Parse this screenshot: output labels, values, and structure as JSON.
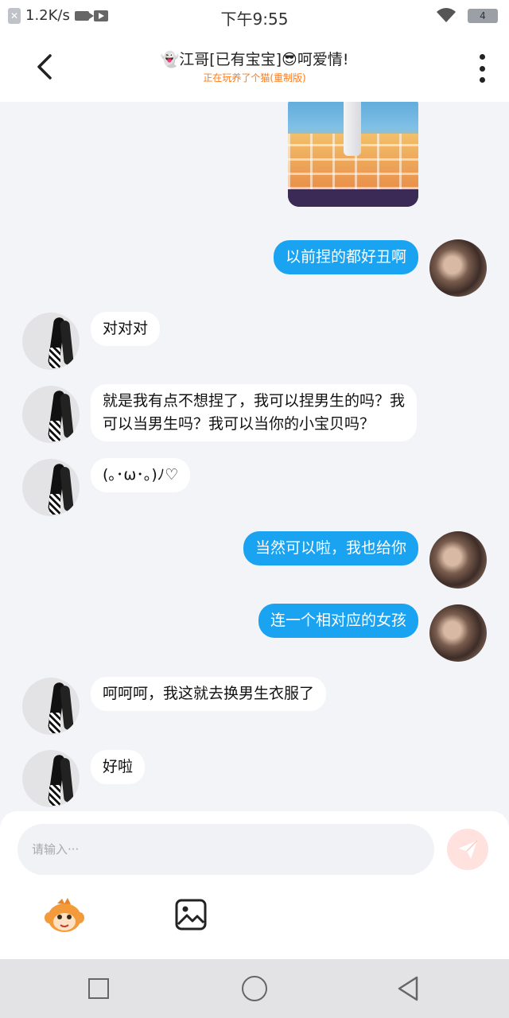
{
  "status_bar": {
    "net_speed": "1.2K/s",
    "time": "下午9:55",
    "battery": "4"
  },
  "header": {
    "title": "👻江哥[已有宝宝]😎呵爱情!",
    "subtitle": "正在玩养了个猫(重制版)"
  },
  "messages": [
    {
      "side": "out",
      "text": "以前捏的都好丑啊"
    },
    {
      "side": "in",
      "text": "对对对"
    },
    {
      "side": "in",
      "text": "就是我有点不想捏了，我可以捏男生的吗？我",
      "text2": "可以当男生吗？我可以当你的小宝贝吗？"
    },
    {
      "side": "in",
      "text": "(｡･ω･｡)ﾉ♡"
    },
    {
      "side": "out",
      "text": "当然可以啦，我也给你"
    },
    {
      "side": "out",
      "text": "连一个相对应的女孩"
    },
    {
      "side": "in",
      "text": "呵呵呵，我这就去换男生衣服了"
    },
    {
      "side": "in",
      "text": "好啦"
    }
  ],
  "input": {
    "placeholder": "请输入···"
  },
  "colors": {
    "outgoing_bubble": "#1aa3f0",
    "incoming_bubble": "#ffffff",
    "subtitle": "#ff7a1a",
    "send_button": "#ffe2de"
  },
  "icons": [
    "back-arrow-icon",
    "more-vertical-icon",
    "send-icon",
    "monkey-emoji-icon",
    "image-icon",
    "recent-apps-icon",
    "home-icon",
    "back-icon"
  ]
}
